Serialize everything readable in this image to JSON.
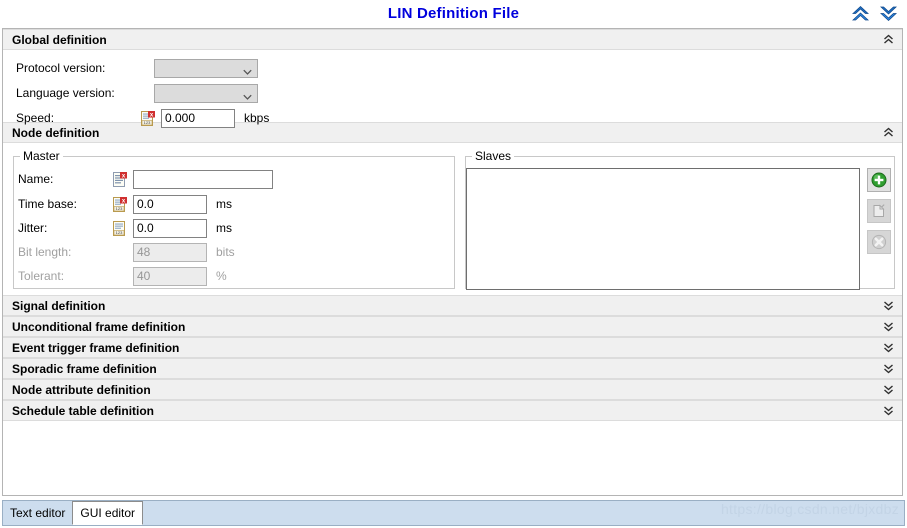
{
  "header": {
    "title": "LIN Definition File",
    "collapse_all_icon": "double-chevron-up-icon",
    "expand_all_icon": "double-chevron-down-icon"
  },
  "sections": {
    "global": {
      "title": "Global definition",
      "expanded": true,
      "chevron_icon": "double-chevron-up-icon",
      "fields": {
        "protocol_version": {
          "label": "Protocol version:",
          "value": "",
          "placeholder": ""
        },
        "language_version": {
          "label": "Language version:",
          "value": "",
          "placeholder": ""
        },
        "speed": {
          "label": "Speed:",
          "value": "0.000",
          "unit": "kbps",
          "icon": "numeric-doc-error-icon"
        }
      }
    },
    "node": {
      "title": "Node definition",
      "expanded": true,
      "chevron_icon": "double-chevron-up-icon",
      "master": {
        "legend": "Master",
        "name": {
          "label": "Name:",
          "value": "",
          "placeholder": "",
          "icon": "doc-error-icon"
        },
        "time_base": {
          "label": "Time base:",
          "value": "0.0",
          "unit": "ms",
          "icon": "numeric-doc-error-icon"
        },
        "jitter": {
          "label": "Jitter:",
          "value": "0.0",
          "unit": "ms",
          "icon": "numeric-doc-icon"
        },
        "bit_length": {
          "label": "Bit length:",
          "value": "48",
          "unit": "bits",
          "disabled": true
        },
        "tolerant": {
          "label": "Tolerant:",
          "value": "40",
          "unit": "%",
          "disabled": true
        }
      },
      "slaves": {
        "legend": "Slaves",
        "items": [],
        "buttons": [
          {
            "name": "add-slave-button",
            "icon": "green-plus-circle-icon",
            "enabled": true
          },
          {
            "name": "edit-slave-button",
            "icon": "edit-node-icon",
            "enabled": false
          },
          {
            "name": "delete-slave-button",
            "icon": "delete-node-icon",
            "enabled": false
          }
        ]
      }
    },
    "collapsed": [
      {
        "title": "Signal definition",
        "chevron_icon": "double-chevron-down-icon"
      },
      {
        "title": "Unconditional frame definition",
        "chevron_icon": "double-chevron-down-icon"
      },
      {
        "title": "Event trigger frame definition",
        "chevron_icon": "double-chevron-down-icon"
      },
      {
        "title": "Sporadic frame definition",
        "chevron_icon": "double-chevron-down-icon"
      },
      {
        "title": "Node attribute definition",
        "chevron_icon": "double-chevron-down-icon"
      },
      {
        "title": "Schedule table definition",
        "chevron_icon": "double-chevron-down-icon"
      }
    ]
  },
  "tabs": {
    "items": [
      {
        "label": "Text editor",
        "active": false
      },
      {
        "label": "GUI editor",
        "active": true
      }
    ]
  },
  "watermark": "https://blog.csdn.net/bjxdbz",
  "colors": {
    "title_blue": "#0000dd",
    "section_header_bg": "#f0f0f0",
    "tabstrip_bg": "#cdddee",
    "accent_green": "#2f9e2f"
  }
}
